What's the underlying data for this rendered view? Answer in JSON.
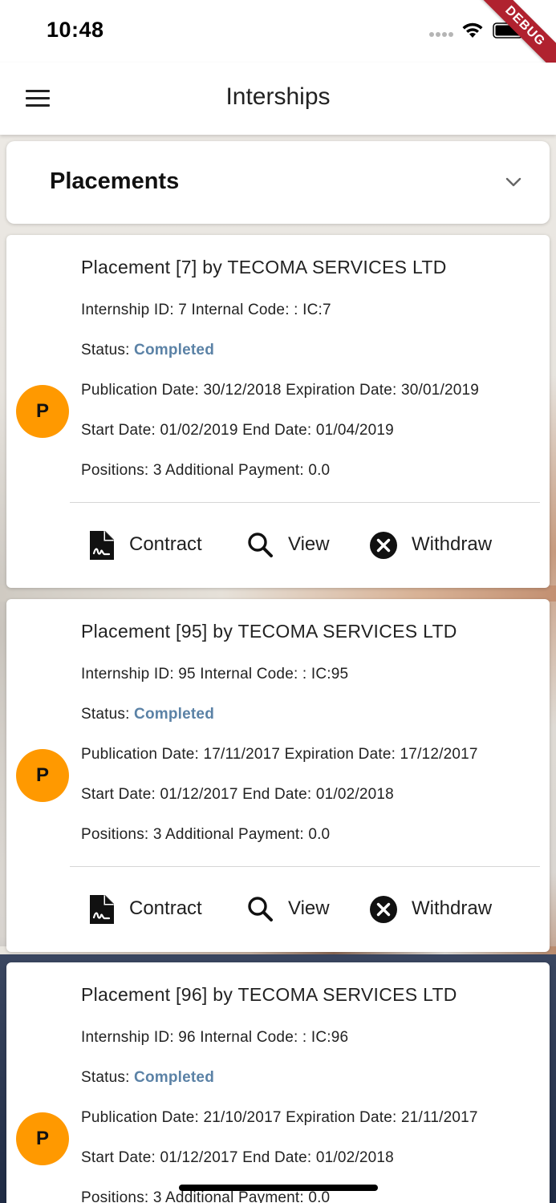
{
  "status_bar": {
    "time": "10:48",
    "debug_label": "DEBUG"
  },
  "app_bar": {
    "title": "Interships",
    "menu_icon": "hamburger-menu-icon"
  },
  "section": {
    "title": "Placements",
    "toggle_icon": "chevron-down-icon"
  },
  "colors": {
    "avatar": "#ff9900",
    "status_completed": "#5b82a6",
    "debug_ribbon": "#b0222f"
  },
  "placements": [
    {
      "avatar_letter": "P",
      "title": "Placement [7] by TECOMA SERVICES LTD",
      "ids": "Internship ID: 7 Internal Code: : IC:7",
      "status_label": "Status: ",
      "status_value": "Completed",
      "dates_pub": "Publication Date: 30/12/2018 Expiration Date: 30/01/2019",
      "dates_period": "Start Date: 01/02/2019 End Date: 01/04/2019",
      "positions": "Positions: 3 Additional Payment: 0.0",
      "actions": {
        "contract": "Contract",
        "view": "View",
        "withdraw": "Withdraw"
      }
    },
    {
      "avatar_letter": "P",
      "title": "Placement [95] by TECOMA SERVICES LTD",
      "ids": "Internship ID: 95 Internal Code: : IC:95",
      "status_label": "Status: ",
      "status_value": "Completed",
      "dates_pub": "Publication Date: 17/11/2017 Expiration Date: 17/12/2017",
      "dates_period": "Start Date: 01/12/2017 End Date: 01/02/2018",
      "positions": "Positions: 3 Additional Payment: 0.0",
      "actions": {
        "contract": "Contract",
        "view": "View",
        "withdraw": "Withdraw"
      }
    },
    {
      "avatar_letter": "P",
      "title": "Placement [96] by TECOMA SERVICES LTD",
      "ids": "Internship ID: 96 Internal Code: : IC:96",
      "status_label": "Status: ",
      "status_value": "Completed",
      "dates_pub": "Publication Date: 21/10/2017 Expiration Date: 21/11/2017",
      "dates_period": "Start Date: 01/12/2017 End Date: 01/02/2018",
      "positions": "Positions: 3 Additional Payment: 0.0"
    }
  ]
}
